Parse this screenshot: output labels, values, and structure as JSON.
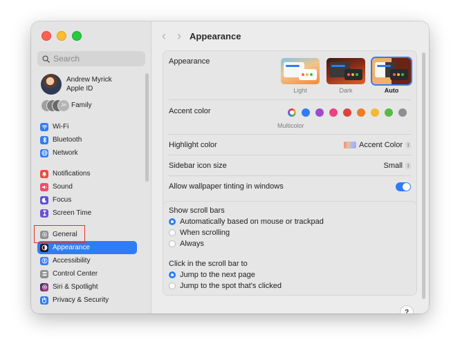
{
  "window": {
    "title": "Appearance"
  },
  "search": {
    "placeholder": "Search"
  },
  "profile": {
    "name": "Andrew Myrick",
    "subtitle": "Apple ID"
  },
  "family": {
    "label": "Family",
    "initials": "JH"
  },
  "sidebar": {
    "items": [
      {
        "label": "Wi-Fi",
        "icon": "wifi-icon",
        "color": "#2f7cf6"
      },
      {
        "label": "Bluetooth",
        "icon": "bluetooth-icon",
        "color": "#2f7cf6"
      },
      {
        "label": "Network",
        "icon": "globe-icon",
        "color": "#2f7cf6"
      },
      {
        "label": "Notifications",
        "icon": "bell-icon",
        "color": "#ef4a3f"
      },
      {
        "label": "Sound",
        "icon": "speaker-icon",
        "color": "#ef4a6a"
      },
      {
        "label": "Focus",
        "icon": "moon-icon",
        "color": "#5d4fd6"
      },
      {
        "label": "Screen Time",
        "icon": "hourglass-icon",
        "color": "#6a4fd6"
      },
      {
        "label": "General",
        "icon": "gear-icon",
        "color": "#8e8e93"
      },
      {
        "label": "Appearance",
        "icon": "appearance-icon",
        "color": "#1d1d1f"
      },
      {
        "label": "Accessibility",
        "icon": "accessibility-icon",
        "color": "#2f7cf6"
      },
      {
        "label": "Control Center",
        "icon": "control-center-icon",
        "color": "#8e8e93"
      },
      {
        "label": "Siri & Spotlight",
        "icon": "siri-icon",
        "color": "#5a3fb0"
      },
      {
        "label": "Privacy & Security",
        "icon": "hand-icon",
        "color": "#2f7cf6"
      }
    ],
    "selected": "Appearance"
  },
  "appearance": {
    "label": "Appearance",
    "options": [
      {
        "label": "Light",
        "selected": false
      },
      {
        "label": "Dark",
        "selected": false
      },
      {
        "label": "Auto",
        "selected": true
      }
    ]
  },
  "accent": {
    "label": "Accent color",
    "selected_caption": "Multicolor",
    "colors": [
      "multicolor",
      "#2f7cf6",
      "#9b4dc9",
      "#e9447f",
      "#e0403a",
      "#f07b22",
      "#f5b82e",
      "#5ab946",
      "#8e8e93"
    ]
  },
  "highlight": {
    "label": "Highlight color",
    "value": "Accent Color"
  },
  "sidebar_icon_size": {
    "label": "Sidebar icon size",
    "value": "Small"
  },
  "wallpaper_tinting": {
    "label": "Allow wallpaper tinting in windows",
    "enabled": true
  },
  "scroll_bars": {
    "label": "Show scroll bars",
    "options": [
      "Automatically based on mouse or trackpad",
      "When scrolling",
      "Always"
    ],
    "selected": 0
  },
  "click_scroll": {
    "label": "Click in the scroll bar to",
    "options": [
      "Jump to the next page",
      "Jump to the spot that's clicked"
    ],
    "selected": 0
  },
  "help": {
    "label": "?"
  },
  "colors": {
    "accent": "#2f7cf6",
    "annotation": "#e0322b"
  }
}
